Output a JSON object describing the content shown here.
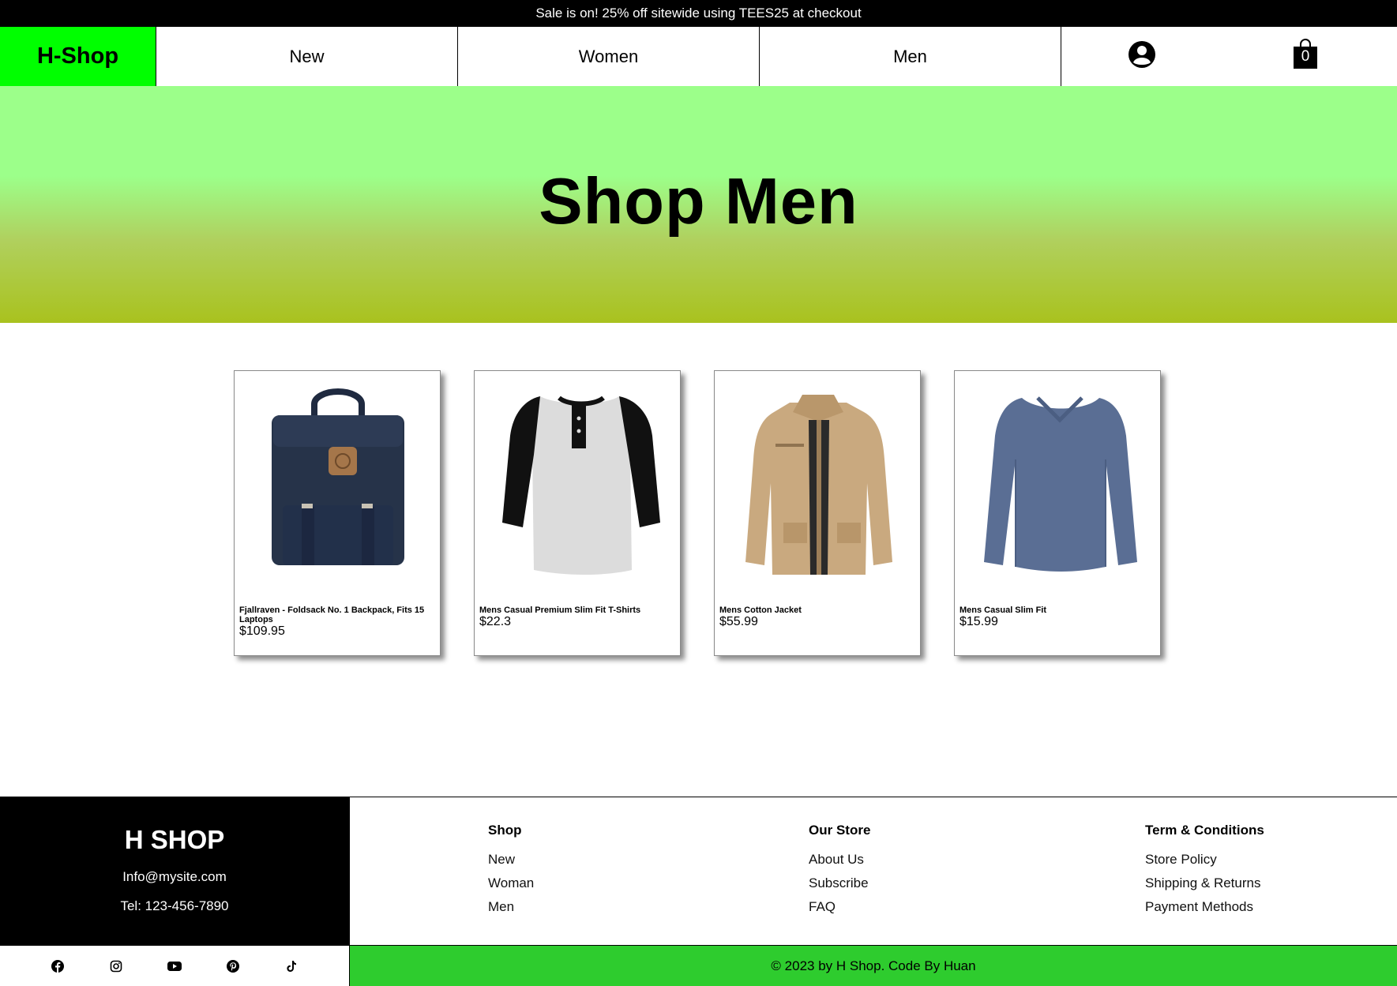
{
  "announcement": "Sale is on! 25% off sitewide using TEES25 at checkout",
  "header": {
    "logo": "H-Shop",
    "nav": [
      {
        "label": "New"
      },
      {
        "label": "Women"
      },
      {
        "label": "Men"
      }
    ],
    "cart_count": "0"
  },
  "hero": {
    "title": "Shop Men"
  },
  "products": [
    {
      "name": "Fjallraven - Foldsack No. 1 Backpack, Fits 15 Laptops",
      "price": "$109.95",
      "image": "navy-backpack"
    },
    {
      "name": "Mens Casual Premium Slim Fit T-Shirts",
      "price": "$22.3",
      "image": "raglan-henley-shirt"
    },
    {
      "name": "Mens Cotton Jacket",
      "price": "$55.99",
      "image": "tan-cotton-jacket"
    },
    {
      "name": "Mens Casual Slim Fit",
      "price": "$15.99",
      "image": "blue-long-sleeve-tee"
    }
  ],
  "footer": {
    "brand": "H SHOP",
    "email": "Info@mysite.com",
    "tel": "Tel: 123-456-7890",
    "columns": [
      {
        "title": "Shop",
        "links": [
          "New",
          "Woman",
          "Men"
        ]
      },
      {
        "title": "Our Store",
        "links": [
          "About Us",
          "Subscribe",
          "FAQ"
        ]
      },
      {
        "title": "Term & Conditions",
        "links": [
          "Store Policy",
          "Shipping & Returns",
          "Payment Methods"
        ]
      }
    ],
    "social": [
      "facebook-icon",
      "instagram-icon",
      "youtube-icon",
      "pinterest-icon",
      "tiktok-icon"
    ],
    "copyright": "© 2023 by H Shop. Code By Huan"
  },
  "colors": {
    "logo_bg": "#00ff00",
    "hero_top": "#9cff8a",
    "hero_bottom": "#a9c21e",
    "copyright_bg": "#2ecc2e"
  }
}
